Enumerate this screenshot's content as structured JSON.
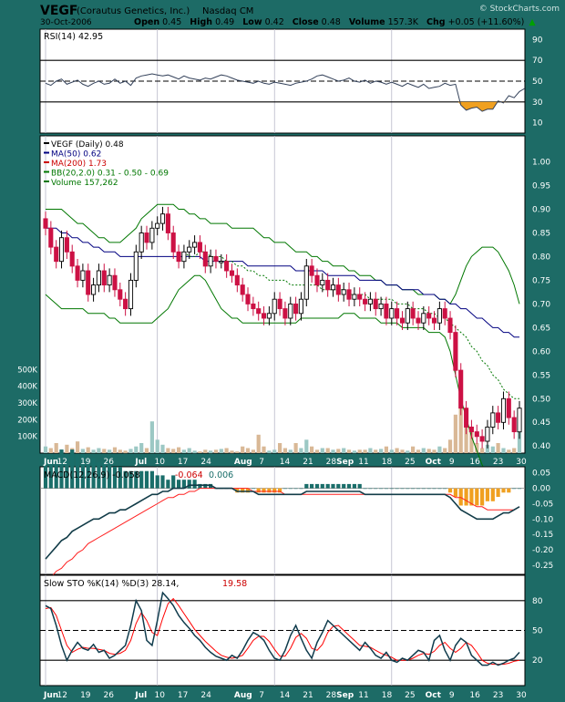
{
  "header": {
    "symbol": "VEGF",
    "company": "(Corautus Genetics, Inc.)",
    "exchange": "Nasdaq CM",
    "watermark": "© StockCharts.com",
    "date": "30-Oct-2006",
    "open_label": "Open",
    "open": "0.45",
    "high_label": "High",
    "high": "0.49",
    "low_label": "Low",
    "low": "0.42",
    "close_label": "Close",
    "close": "0.48",
    "volume_label": "Volume",
    "volume": "157.3K",
    "chg_label": "Chg",
    "chg": "+0.05 (+11.60%)",
    "chg_symbol": "▲"
  },
  "colors": {
    "background": "#1d6b66",
    "up": "#000000",
    "down": "#cc1144",
    "ma50": "#000080",
    "ma200": "#cc0000",
    "bb": "#007700",
    "volume_up": "#9cc8c4",
    "volume_down": "#d9b896",
    "rsi_oversold_fill": "#f0a020",
    "macd_histogram": "#1a6e6a",
    "macd_hist_neg": "#f0a020",
    "slow_k": "#0f3b4c",
    "slow_d": "#ff0000"
  },
  "x_axis": {
    "labels": [
      "Jun",
      "12",
      "19",
      "26",
      "Jul",
      "10",
      "17",
      "24",
      "Aug",
      "7",
      "14",
      "21",
      "28",
      "Sep",
      "11",
      "18",
      "25",
      "Oct",
      "9",
      "16",
      "23",
      "30"
    ]
  },
  "chart_data": [
    {
      "type": "line",
      "panel": "rsi",
      "legend": "RSI(14) 42.95",
      "y_ticks": [
        "90",
        "70",
        "50",
        "30",
        "10"
      ],
      "ylim": [
        0,
        100
      ],
      "reference_lines": [
        70,
        50,
        30
      ],
      "values": [
        48,
        46,
        50,
        52,
        47,
        49,
        51,
        47,
        45,
        48,
        50,
        47,
        48,
        52,
        48,
        50,
        46,
        53,
        55,
        56,
        57,
        56,
        55,
        56,
        54,
        52,
        55,
        53,
        52,
        51,
        53,
        52,
        54,
        56,
        55,
        53,
        51,
        50,
        49,
        48,
        50,
        48,
        47,
        49,
        48,
        47,
        46,
        48,
        49,
        50,
        52,
        55,
        56,
        54,
        52,
        50,
        51,
        53,
        50,
        49,
        51,
        48,
        50,
        49,
        47,
        49,
        47,
        45,
        48,
        46,
        44,
        47,
        43,
        44,
        45,
        48,
        46,
        47,
        27,
        22,
        24,
        25,
        21,
        23,
        23,
        31,
        29,
        36,
        34,
        40,
        43
      ]
    },
    {
      "type": "candlestick",
      "panel": "price",
      "legend": [
        {
          "key": "price",
          "text": "VEGF (Daily) 0.48"
        },
        {
          "key": "ma50",
          "text": "MA(50) 0.62"
        },
        {
          "key": "ma200",
          "text": "MA(200) 1.73"
        },
        {
          "key": "bb",
          "text": "BB(20,2.0) 0.31 - 0.50 - 0.69"
        },
        {
          "key": "volume",
          "text": "Volume 157,262"
        }
      ],
      "y_ticks": [
        "1.00",
        "0.95",
        "0.90",
        "0.85",
        "0.80",
        "0.75",
        "0.70",
        "0.65",
        "0.60",
        "0.55",
        "0.50",
        "0.45",
        "0.40"
      ],
      "ylim": [
        0.385,
        1.055
      ],
      "volume_ticks": [
        "500K",
        "400K",
        "300K",
        "200K",
        "100K"
      ],
      "volume_max": 600000,
      "close": [
        0.86,
        0.82,
        0.79,
        0.84,
        0.81,
        0.78,
        0.75,
        0.77,
        0.72,
        0.74,
        0.77,
        0.74,
        0.76,
        0.73,
        0.71,
        0.69,
        0.75,
        0.81,
        0.85,
        0.83,
        0.86,
        0.87,
        0.89,
        0.85,
        0.81,
        0.79,
        0.81,
        0.82,
        0.83,
        0.81,
        0.78,
        0.8,
        0.79,
        0.79,
        0.77,
        0.76,
        0.74,
        0.72,
        0.7,
        0.69,
        0.68,
        0.67,
        0.68,
        0.71,
        0.69,
        0.67,
        0.7,
        0.68,
        0.71,
        0.78,
        0.76,
        0.74,
        0.75,
        0.73,
        0.74,
        0.72,
        0.73,
        0.71,
        0.72,
        0.71,
        0.7,
        0.71,
        0.69,
        0.7,
        0.67,
        0.69,
        0.67,
        0.66,
        0.69,
        0.67,
        0.66,
        0.68,
        0.67,
        0.66,
        0.69,
        0.67,
        0.64,
        0.56,
        0.48,
        0.44,
        0.43,
        0.42,
        0.41,
        0.44,
        0.47,
        0.45,
        0.5,
        0.46,
        0.43,
        0.48
      ],
      "ma50": [
        0.86,
        0.86,
        0.86,
        0.85,
        0.85,
        0.84,
        0.84,
        0.83,
        0.83,
        0.82,
        0.82,
        0.81,
        0.81,
        0.81,
        0.8,
        0.8,
        0.8,
        0.8,
        0.8,
        0.8,
        0.8,
        0.8,
        0.8,
        0.8,
        0.8,
        0.8,
        0.8,
        0.8,
        0.8,
        0.8,
        0.79,
        0.79,
        0.79,
        0.79,
        0.79,
        0.79,
        0.79,
        0.79,
        0.78,
        0.78,
        0.78,
        0.78,
        0.78,
        0.78,
        0.78,
        0.78,
        0.78,
        0.77,
        0.77,
        0.77,
        0.77,
        0.77,
        0.77,
        0.76,
        0.76,
        0.76,
        0.76,
        0.76,
        0.76,
        0.75,
        0.75,
        0.75,
        0.75,
        0.75,
        0.74,
        0.74,
        0.74,
        0.73,
        0.73,
        0.73,
        0.73,
        0.72,
        0.72,
        0.72,
        0.71,
        0.71,
        0.7,
        0.7,
        0.69,
        0.69,
        0.68,
        0.67,
        0.67,
        0.66,
        0.65,
        0.65,
        0.64,
        0.64,
        0.63,
        0.63
      ],
      "ma200_visible": [
        null,
        null,
        null,
        null,
        null,
        null,
        null,
        null,
        null,
        null,
        null,
        null,
        null,
        null,
        null,
        null,
        null,
        null,
        null,
        null,
        null,
        null,
        null,
        null,
        null,
        null,
        0.81,
        0.8,
        0.8,
        0.81,
        0.81,
        0.8,
        0.8,
        0.8,
        0.79,
        0.79,
        0.78,
        0.78,
        0.77,
        0.77,
        0.76,
        0.76,
        0.75,
        0.75,
        0.75,
        0.75,
        0.74,
        0.74,
        0.74,
        0.74,
        0.74,
        0.74,
        0.73,
        0.73,
        0.73,
        0.73,
        0.73,
        0.72,
        0.72,
        0.72,
        0.72,
        0.71,
        0.71,
        0.71,
        0.71,
        0.71,
        0.7,
        0.7,
        0.7,
        0.69,
        0.69,
        0.69,
        0.68,
        0.68,
        0.67,
        0.67,
        0.66,
        0.65,
        0.64,
        0.63,
        0.61,
        0.6,
        0.58,
        0.57,
        0.55,
        0.54,
        0.52,
        0.51,
        0.5,
        0.5
      ],
      "bb_upper": [
        0.9,
        0.9,
        0.9,
        0.9,
        0.89,
        0.88,
        0.87,
        0.87,
        0.86,
        0.85,
        0.84,
        0.84,
        0.83,
        0.83,
        0.83,
        0.84,
        0.85,
        0.86,
        0.88,
        0.89,
        0.9,
        0.91,
        0.91,
        0.91,
        0.91,
        0.9,
        0.9,
        0.89,
        0.89,
        0.88,
        0.88,
        0.87,
        0.87,
        0.87,
        0.87,
        0.86,
        0.86,
        0.86,
        0.86,
        0.86,
        0.85,
        0.84,
        0.84,
        0.83,
        0.83,
        0.83,
        0.82,
        0.81,
        0.81,
        0.81,
        0.8,
        0.8,
        0.79,
        0.79,
        0.78,
        0.78,
        0.78,
        0.77,
        0.77,
        0.76,
        0.76,
        0.76,
        0.75,
        0.75,
        0.74,
        0.74,
        0.74,
        0.73,
        0.73,
        0.73,
        0.72,
        0.72,
        0.72,
        0.72,
        0.71,
        0.71,
        0.7,
        0.72,
        0.75,
        0.78,
        0.8,
        0.81,
        0.82,
        0.82,
        0.82,
        0.81,
        0.79,
        0.77,
        0.74,
        0.7
      ],
      "bb_lower": [
        0.72,
        0.71,
        0.7,
        0.69,
        0.69,
        0.69,
        0.69,
        0.69,
        0.68,
        0.68,
        0.68,
        0.68,
        0.67,
        0.67,
        0.66,
        0.66,
        0.66,
        0.66,
        0.66,
        0.66,
        0.66,
        0.67,
        0.68,
        0.69,
        0.71,
        0.73,
        0.74,
        0.75,
        0.76,
        0.76,
        0.75,
        0.73,
        0.71,
        0.69,
        0.68,
        0.67,
        0.67,
        0.66,
        0.66,
        0.66,
        0.66,
        0.66,
        0.66,
        0.66,
        0.66,
        0.66,
        0.66,
        0.66,
        0.67,
        0.67,
        0.67,
        0.67,
        0.67,
        0.67,
        0.67,
        0.67,
        0.68,
        0.68,
        0.68,
        0.67,
        0.67,
        0.67,
        0.67,
        0.66,
        0.66,
        0.66,
        0.66,
        0.65,
        0.65,
        0.65,
        0.65,
        0.65,
        0.64,
        0.64,
        0.64,
        0.63,
        0.6,
        0.55,
        0.5,
        0.46,
        0.42,
        0.39,
        0.36,
        0.34,
        0.33,
        0.33,
        0.32,
        0.31,
        0.31,
        0.31
      ],
      "volume": [
        40000,
        30000,
        60000,
        20000,
        50000,
        30000,
        70000,
        25000,
        35000,
        20000,
        30000,
        25000,
        20000,
        35000,
        20000,
        15000,
        25000,
        40000,
        60000,
        30000,
        190000,
        80000,
        50000,
        30000,
        25000,
        35000,
        20000,
        30000,
        15000,
        10000,
        20000,
        15000,
        20000,
        25000,
        30000,
        15000,
        10000,
        40000,
        30000,
        20000,
        110000,
        40000,
        15000,
        20000,
        60000,
        30000,
        20000,
        60000,
        30000,
        80000,
        40000,
        20000,
        30000,
        30000,
        20000,
        25000,
        30000,
        20000,
        15000,
        20000,
        20000,
        30000,
        20000,
        25000,
        40000,
        20000,
        30000,
        20000,
        15000,
        40000,
        20000,
        30000,
        25000,
        20000,
        40000,
        30000,
        80000,
        230000,
        320000,
        270000,
        150000,
        60000,
        30000,
        50000,
        40000,
        60000,
        30000,
        20000,
        30000,
        157262
      ]
    },
    {
      "type": "line",
      "panel": "macd",
      "legend": [
        {
          "key": "macd",
          "text": "MACD(12,26,9) -0.058"
        },
        {
          "key": "signal",
          "text": "-0.064"
        },
        {
          "key": "hist",
          "text": "0.006"
        }
      ],
      "y_ticks": [
        "0.05",
        "0.00",
        "-0.05",
        "-0.10",
        "-0.15",
        "-0.20",
        "-0.25"
      ],
      "ylim": [
        -0.28,
        0.07
      ],
      "macd": [
        -0.23,
        -0.21,
        -0.19,
        -0.17,
        -0.16,
        -0.14,
        -0.13,
        -0.12,
        -0.11,
        -0.1,
        -0.1,
        -0.09,
        -0.08,
        -0.08,
        -0.07,
        -0.07,
        -0.06,
        -0.05,
        -0.04,
        -0.03,
        -0.02,
        -0.02,
        -0.01,
        -0.01,
        0.0,
        0.0,
        0.0,
        0.01,
        0.01,
        0.01,
        0.01,
        0.01,
        0.0,
        0.0,
        0.0,
        0.0,
        -0.01,
        -0.01,
        -0.01,
        -0.01,
        -0.02,
        -0.02,
        -0.02,
        -0.02,
        -0.02,
        -0.02,
        -0.02,
        -0.02,
        -0.02,
        -0.01,
        -0.01,
        -0.01,
        -0.01,
        -0.01,
        -0.01,
        -0.01,
        -0.01,
        -0.01,
        -0.01,
        -0.01,
        -0.02,
        -0.02,
        -0.02,
        -0.02,
        -0.02,
        -0.02,
        -0.02,
        -0.02,
        -0.02,
        -0.02,
        -0.02,
        -0.02,
        -0.02,
        -0.02,
        -0.02,
        -0.02,
        -0.03,
        -0.05,
        -0.07,
        -0.08,
        -0.09,
        -0.1,
        -0.1,
        -0.1,
        -0.1,
        -0.09,
        -0.08,
        -0.08,
        -0.07,
        -0.06
      ],
      "signal": [
        -0.3,
        -0.29,
        -0.27,
        -0.26,
        -0.24,
        -0.23,
        -0.21,
        -0.2,
        -0.18,
        -0.17,
        -0.16,
        -0.15,
        -0.14,
        -0.13,
        -0.12,
        -0.11,
        -0.1,
        -0.09,
        -0.08,
        -0.07,
        -0.06,
        -0.05,
        -0.04,
        -0.03,
        -0.03,
        -0.02,
        -0.02,
        -0.01,
        -0.01,
        0.0,
        0.0,
        0.0,
        0.0,
        0.0,
        0.0,
        0.0,
        0.0,
        0.0,
        0.0,
        -0.01,
        -0.01,
        -0.01,
        -0.01,
        -0.01,
        -0.01,
        -0.02,
        -0.02,
        -0.02,
        -0.02,
        -0.02,
        -0.02,
        -0.02,
        -0.02,
        -0.02,
        -0.02,
        -0.02,
        -0.02,
        -0.02,
        -0.02,
        -0.02,
        -0.02,
        -0.02,
        -0.02,
        -0.02,
        -0.02,
        -0.02,
        -0.02,
        -0.02,
        -0.02,
        -0.02,
        -0.02,
        -0.02,
        -0.02,
        -0.02,
        -0.02,
        -0.02,
        -0.02,
        -0.03,
        -0.03,
        -0.04,
        -0.05,
        -0.06,
        -0.06,
        -0.07,
        -0.07,
        -0.07,
        -0.07,
        -0.07,
        -0.07,
        -0.06
      ]
    },
    {
      "type": "line",
      "panel": "slow_sto",
      "legend": [
        {
          "key": "k",
          "text": "Slow STO %K(14) %D(3) 28.14,"
        },
        {
          "key": "d",
          "text": "19.58"
        }
      ],
      "y_ticks": [
        "80",
        "50",
        "20"
      ],
      "ylim": [
        0,
        100
      ],
      "reference_lines": [
        80,
        50,
        20
      ],
      "k": [
        75,
        72,
        55,
        35,
        20,
        30,
        38,
        32,
        30,
        36,
        28,
        30,
        22,
        25,
        30,
        35,
        55,
        80,
        70,
        40,
        35,
        60,
        88,
        82,
        75,
        65,
        58,
        52,
        45,
        40,
        33,
        28,
        24,
        22,
        20,
        25,
        22,
        30,
        40,
        48,
        45,
        40,
        30,
        22,
        20,
        30,
        45,
        55,
        42,
        30,
        22,
        38,
        48,
        60,
        55,
        50,
        45,
        40,
        35,
        30,
        38,
        32,
        25,
        22,
        28,
        20,
        18,
        22,
        20,
        25,
        30,
        28,
        20,
        40,
        45,
        30,
        20,
        35,
        42,
        38,
        25,
        20,
        15,
        15,
        18,
        15,
        17,
        20,
        22,
        28
      ],
      "d": [
        72,
        73,
        65,
        50,
        35,
        28,
        31,
        33,
        32,
        32,
        31,
        30,
        27,
        26,
        27,
        30,
        40,
        57,
        68,
        60,
        48,
        45,
        62,
        77,
        82,
        75,
        67,
        59,
        51,
        45,
        39,
        34,
        29,
        25,
        23,
        22,
        23,
        25,
        32,
        40,
        44,
        44,
        39,
        31,
        24,
        24,
        32,
        43,
        47,
        42,
        32,
        30,
        36,
        48,
        54,
        55,
        50,
        45,
        40,
        35,
        34,
        33,
        30,
        27,
        25,
        23,
        20,
        20,
        20,
        22,
        25,
        27,
        26,
        29,
        35,
        38,
        32,
        28,
        32,
        38,
        35,
        28,
        20,
        17,
        16,
        16,
        16,
        17,
        19,
        20
      ]
    }
  ]
}
